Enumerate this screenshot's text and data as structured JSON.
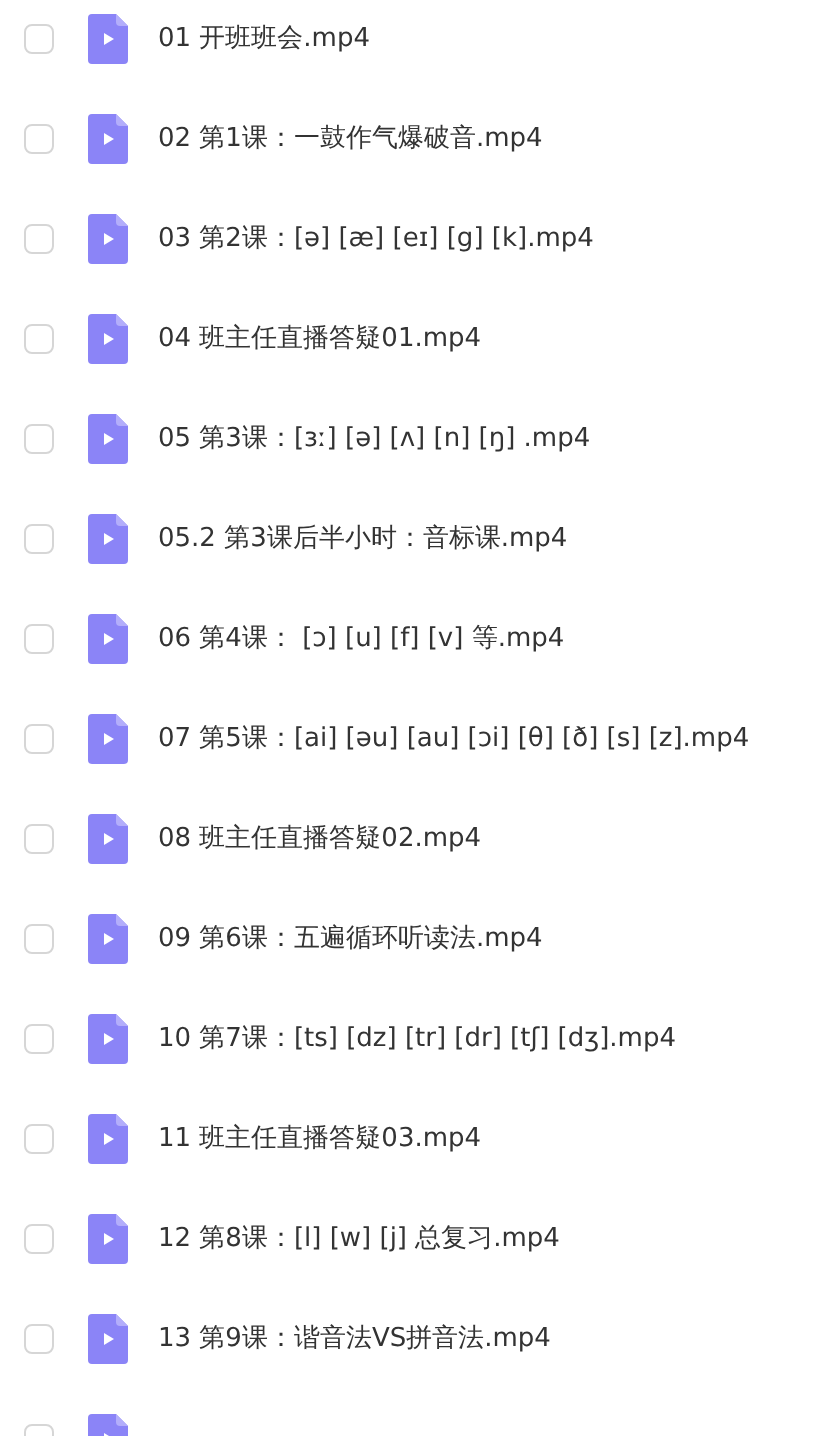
{
  "files": [
    {
      "name": "01 开班班会.mp4",
      "checked": false
    },
    {
      "name": "02 第1课：一鼓作气爆破音.mp4",
      "checked": false
    },
    {
      "name": "03 第2课：[ə] [æ] [eɪ] [g] [k].mp4",
      "checked": false
    },
    {
      "name": "04 班主任直播答疑01.mp4",
      "checked": false
    },
    {
      "name": "05 第3课：[ɜː] [ə] [ʌ] [n] [ŋ] .mp4",
      "checked": false
    },
    {
      "name": "05.2 第3课后半小时：音标课.mp4",
      "checked": false
    },
    {
      "name": "06 第4课： [ɔ] [u] [f] [v] 等.mp4",
      "checked": false
    },
    {
      "name": "07 第5课：[ai] [əu] [au] [ɔi] [θ] [ð] [s] [z].mp4",
      "checked": false
    },
    {
      "name": "08 班主任直播答疑02.mp4",
      "checked": false
    },
    {
      "name": "09 第6课：五遍循环听读法.mp4",
      "checked": false
    },
    {
      "name": "10 第7课：[ts] [dz] [tr] [dr] [tʃ] [dʒ].mp4",
      "checked": false
    },
    {
      "name": "11 班主任直播答疑03.mp4",
      "checked": false
    },
    {
      "name": "12 第8课：[l] [w] [j] 总复习.mp4",
      "checked": false
    },
    {
      "name": "13 第9课：谐音法VS拼音法.mp4",
      "checked": false
    },
    {
      "checked": false
    }
  ]
}
